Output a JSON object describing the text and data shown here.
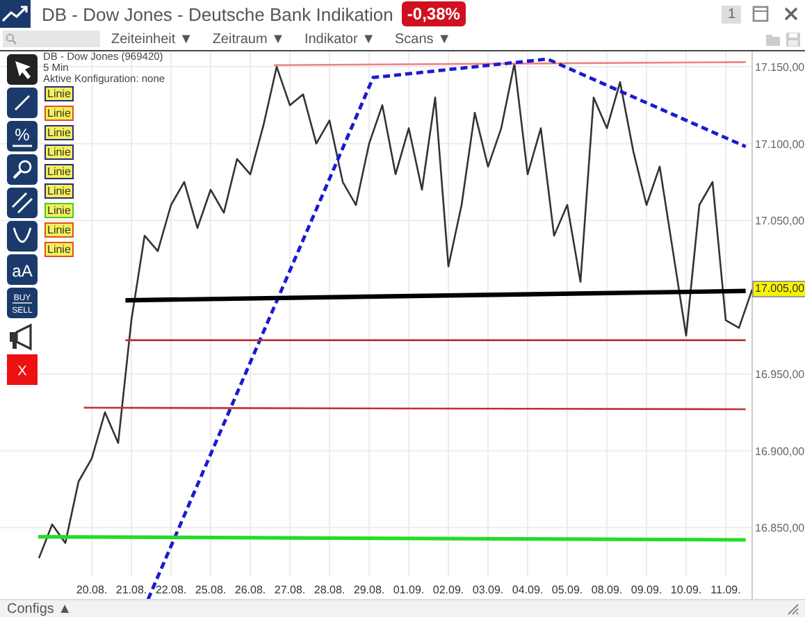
{
  "window": {
    "title": "DB - Dow Jones - Deutsche Bank Indikation",
    "change": "-0,38%",
    "page_number": "1"
  },
  "toolbar": {
    "menus": [
      "Zeiteinheit ▼",
      "Zeitraum ▼",
      "Indikator ▼",
      "Scans ▼"
    ]
  },
  "chart": {
    "instrument": "DB - Dow Jones (969420)",
    "interval": "5 Min",
    "config": "Aktive Konfiguration: none",
    "price_label": "17.005,00",
    "chart_data": {
      "type": "line",
      "ylim": [
        16818,
        17160
      ],
      "grid": true,
      "categories": [
        null,
        null,
        null,
        null,
        "20.08.",
        null,
        null,
        "21.08.",
        null,
        null,
        "22.08.",
        null,
        null,
        "25.08.",
        null,
        null,
        "26.08.",
        null,
        null,
        "27.08.",
        null,
        null,
        "28.08.",
        null,
        null,
        "29.08.",
        null,
        null,
        "01.09.",
        null,
        null,
        "02.09.",
        null,
        null,
        "03.09.",
        null,
        null,
        "04.09.",
        null,
        null,
        "05.09.",
        null,
        null,
        "08.09.",
        null,
        null,
        "09.09.",
        null,
        null,
        "10.09.",
        null,
        null,
        "11.09.",
        null,
        null
      ],
      "yticks": [
        {
          "value": 17150,
          "label": "17.150,00"
        },
        {
          "value": 17100,
          "label": "17.100,00"
        },
        {
          "value": 17050,
          "label": "17.050,00"
        },
        {
          "value": 16950,
          "label": "16.950,00"
        },
        {
          "value": 16900,
          "label": "16.900,00"
        },
        {
          "value": 16850,
          "label": "16.850,00"
        }
      ],
      "series": [
        {
          "color": "#333333",
          "values": [
            16830,
            16852,
            16840,
            16880,
            16895,
            16925,
            16905,
            16985,
            17040,
            17030,
            17060,
            17075,
            17045,
            17070,
            17055,
            17090,
            17080,
            17112,
            17150,
            17125,
            17132,
            17100,
            17115,
            17075,
            17060,
            17100,
            17125,
            17080,
            17110,
            17070,
            17130,
            17020,
            17060,
            17120,
            17085,
            17110,
            17152,
            17080,
            17110,
            17040,
            17060,
            17010,
            17130,
            17110,
            17140,
            17095,
            17060,
            17085,
            17030,
            16975,
            17060,
            17075,
            16985,
            16980,
            17005
          ]
        }
      ]
    }
  },
  "tool_buttons": [
    {
      "kind": "pointer"
    },
    {
      "kind": "line"
    },
    {
      "kind": "percent",
      "label": "%"
    },
    {
      "kind": "zoom"
    },
    {
      "kind": "parallel"
    },
    {
      "kind": "curve"
    },
    {
      "kind": "text",
      "label": "aA"
    },
    {
      "kind": "trade",
      "label": "BUY",
      "label2": "SELL"
    },
    {
      "kind": "alert"
    },
    {
      "kind": "delete",
      "label": "X"
    }
  ],
  "drawn_lines": [
    {
      "label": "Linie",
      "color": "#2a2a80"
    },
    {
      "label": "Linie",
      "color": "#e05020"
    },
    {
      "label": "Linie",
      "color": "#2a2a80"
    },
    {
      "label": "Linie",
      "color": "#2a2a80"
    },
    {
      "label": "Linie",
      "color": "#2a2a80"
    },
    {
      "label": "Linie",
      "color": "#2a2a80"
    },
    {
      "label": "Linie",
      "color": "#44cc22"
    },
    {
      "label": "Linie",
      "color": "#e05020"
    },
    {
      "label": "Linie",
      "color": "#e05020"
    }
  ],
  "footer": {
    "configs": "Configs ▲"
  }
}
